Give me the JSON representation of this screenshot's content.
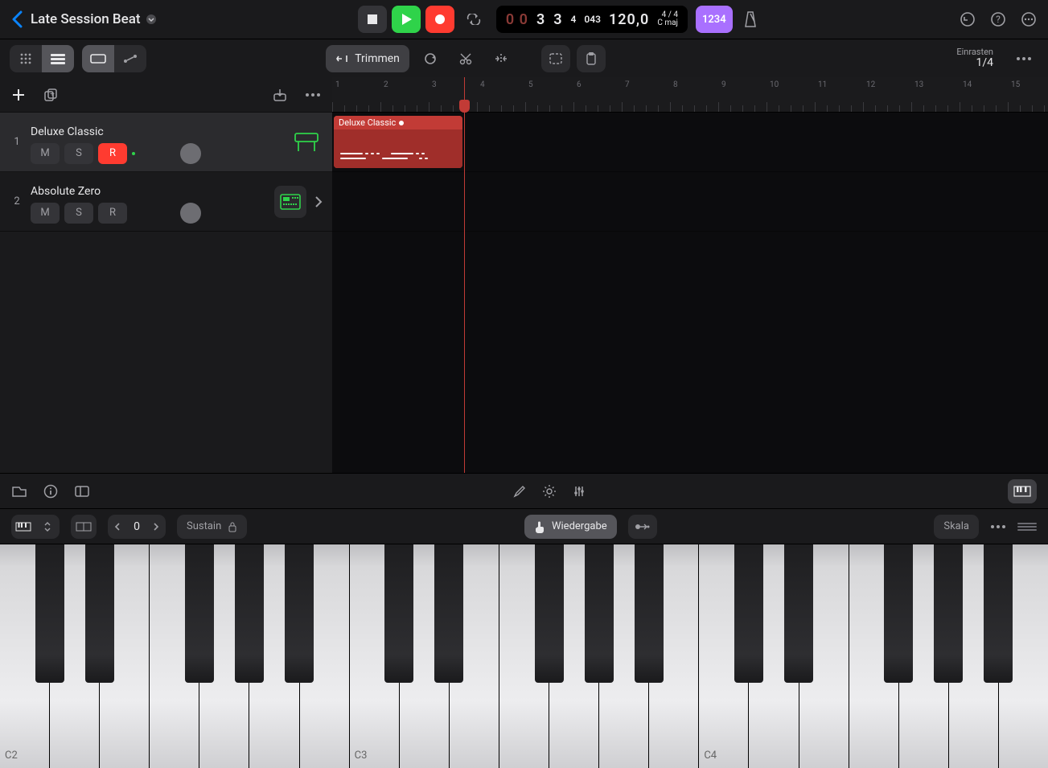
{
  "project": {
    "title": "Late Session Beat"
  },
  "transport": {
    "bars": "3",
    "beats": "3",
    "division": "4",
    "ticks": "043",
    "tempo": "120,0",
    "time_sig": "4 / 4",
    "key": "C maj",
    "count_in": "1234"
  },
  "toolbar": {
    "trim_label": "Trimmen"
  },
  "snap": {
    "label": "Einrasten",
    "value": "1/4"
  },
  "tracks": [
    {
      "num": "1",
      "name": "Deluxe Classic",
      "mute": "M",
      "solo": "S",
      "rec": "R",
      "selected": true,
      "rec_enabled": true,
      "icon_color": "#2fd34a"
    },
    {
      "num": "2",
      "name": "Absolute Zero",
      "mute": "M",
      "solo": "S",
      "rec": "R",
      "selected": false,
      "rec_enabled": false,
      "icon_color": "#2fd34a"
    }
  ],
  "region": {
    "label": "Deluxe Classic"
  },
  "ruler": {
    "bars": [
      "1",
      "2",
      "3",
      "4",
      "5",
      "6",
      "7",
      "8",
      "9",
      "10",
      "11",
      "12",
      "13",
      "14",
      "15"
    ]
  },
  "keyboard": {
    "sustain": "Sustain",
    "octave": "0",
    "play_label": "Wiedergabe",
    "scale": "Skala",
    "c_labels": [
      "C2",
      "C3",
      "C4"
    ]
  }
}
